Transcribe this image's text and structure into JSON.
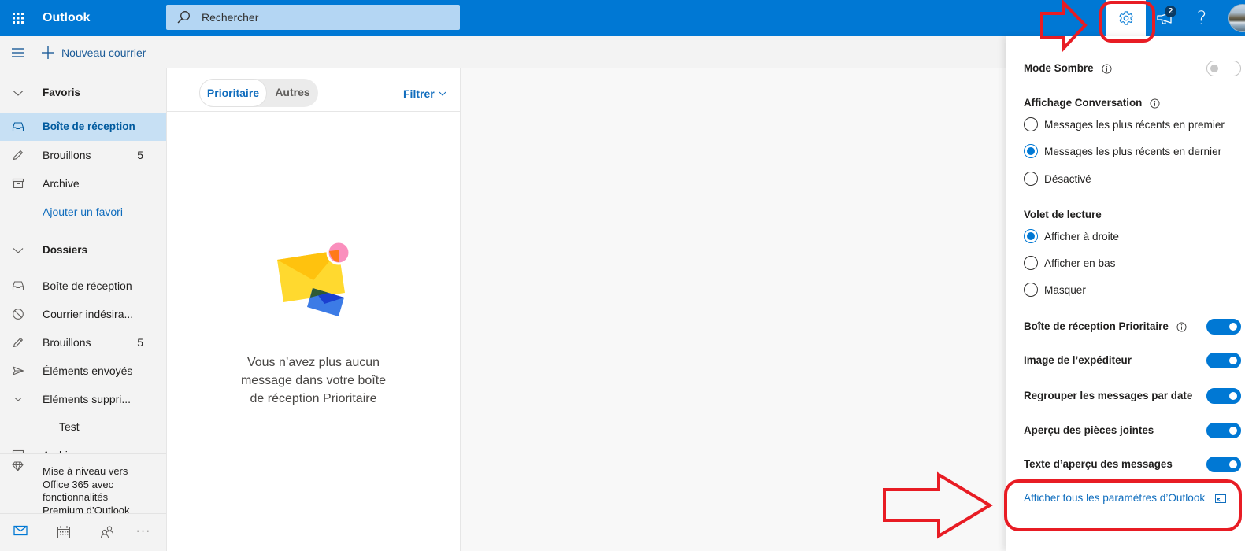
{
  "app": {
    "name": "Outlook"
  },
  "theme": {
    "accent": "#0078d4",
    "selected_bg": "#c7e0f4",
    "annotation_color": "#e81c24"
  },
  "search": {
    "placeholder": "Rechercher"
  },
  "header": {
    "icons": [
      "app-launcher-icon",
      "settings-gear-icon",
      "megaphone-icon",
      "help-icon",
      "avatar"
    ],
    "settings_active": true,
    "notification_badge": "2",
    "help_label": "?"
  },
  "toolbar": {
    "new_mail_label": "Nouveau courrier"
  },
  "sidebar": {
    "favorites": {
      "header": "Favoris",
      "items": [
        {
          "label": "Boîte de réception",
          "icon": "inbox-icon",
          "selected": true
        },
        {
          "label": "Brouillons",
          "icon": "pencil-icon",
          "count": "5"
        },
        {
          "label": "Archive",
          "icon": "archive-icon"
        }
      ],
      "add_favorite": "Ajouter un favori"
    },
    "folders": {
      "header": "Dossiers",
      "items": [
        {
          "label": "Boîte de réception",
          "icon": "inbox-icon"
        },
        {
          "label": "Courrier indésira...",
          "icon": "block-icon"
        },
        {
          "label": "Brouillons",
          "icon": "pencil-icon",
          "count": "5"
        },
        {
          "label": "Éléments envoyés",
          "icon": "send-icon"
        },
        {
          "label": "Éléments suppri...",
          "icon": "chevron-down-icon"
        },
        {
          "label": "Test",
          "icon": ""
        },
        {
          "label": "Archive",
          "icon": "archive-icon"
        }
      ]
    },
    "upgrade": {
      "lines": [
        "Mise à niveau vers",
        "Office 365 avec",
        "fonctionnalités",
        "Premium d’Outlook"
      ]
    },
    "bottom_nav": [
      {
        "name": "mail",
        "active": true
      },
      {
        "name": "calendar",
        "active": false
      },
      {
        "name": "people",
        "active": false
      },
      {
        "name": "more",
        "label": "···",
        "active": false
      }
    ]
  },
  "message_list": {
    "tabs": [
      {
        "label": "Prioritaire",
        "selected": true
      },
      {
        "label": "Autres",
        "selected": false
      }
    ],
    "filter_label": "Filtrer",
    "empty_state": {
      "lines": [
        "Vous n’avez plus aucun",
        "message dans votre boîte",
        "de réception Prioritaire"
      ]
    }
  },
  "settings": {
    "dark_mode": {
      "label": "Mode Sombre",
      "on": false
    },
    "conversation": {
      "header": "Affichage Conversation",
      "options": [
        {
          "label": "Messages les plus récents en premier",
          "selected": false
        },
        {
          "label": "Messages les plus récents en dernier",
          "selected": true
        },
        {
          "label": "Désactivé",
          "selected": false
        }
      ]
    },
    "reading_pane": {
      "header": "Volet de lecture",
      "options": [
        {
          "label": "Afficher à droite",
          "selected": true
        },
        {
          "label": "Afficher en bas",
          "selected": false
        },
        {
          "label": "Masquer",
          "selected": false
        }
      ]
    },
    "toggles": [
      {
        "label": "Boîte de réception Prioritaire",
        "on": true
      },
      {
        "label": "Image de l’expéditeur",
        "on": true
      },
      {
        "label": "Regrouper les messages par date",
        "on": true
      },
      {
        "label": "Aperçu des pièces jointes",
        "on": true
      },
      {
        "label": "Texte d’aperçu des messages",
        "on": true
      }
    ],
    "all_settings_link": "Afficher tous les paramètres d’Outlook"
  }
}
